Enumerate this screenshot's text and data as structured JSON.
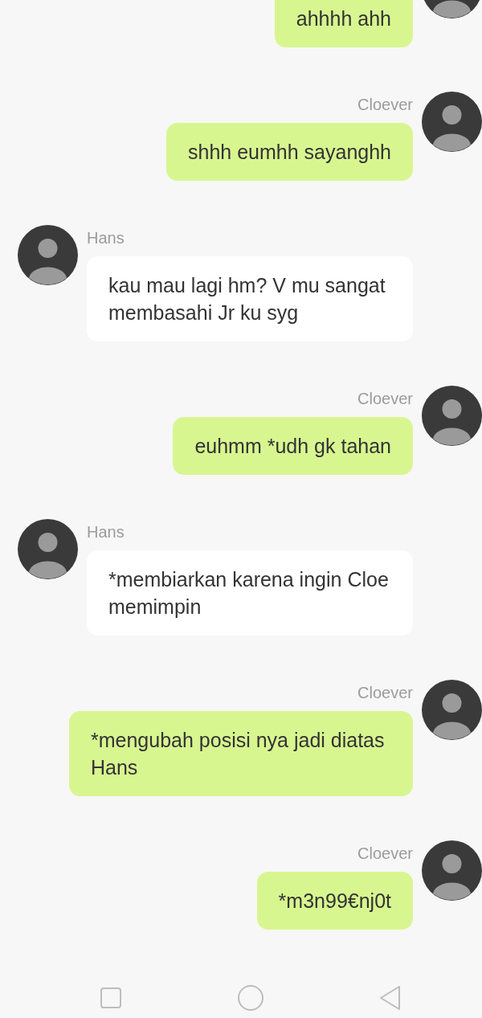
{
  "messages": [
    {
      "kind": "outgoing",
      "text": "ahhhh ahh"
    },
    {
      "kind": "outgoing",
      "sender": "Cloever",
      "text": "shhh eumhh sayanghh"
    },
    {
      "kind": "incoming",
      "sender": "Hans",
      "text": "kau mau lagi hm? V mu sangat membasahi Jr ku syg"
    },
    {
      "kind": "outgoing",
      "sender": "Cloever",
      "text": "euhmm *udh gk tahan"
    },
    {
      "kind": "incoming",
      "sender": "Hans",
      "text": "*membiarkan karena ingin Cloe memimpin"
    },
    {
      "kind": "outgoing",
      "sender": "Cloever",
      "text": "*mengubah posisi nya jadi diatas Hans"
    },
    {
      "kind": "outgoing",
      "sender": "Cloever",
      "text": "*m3n99€nj0t"
    }
  ]
}
